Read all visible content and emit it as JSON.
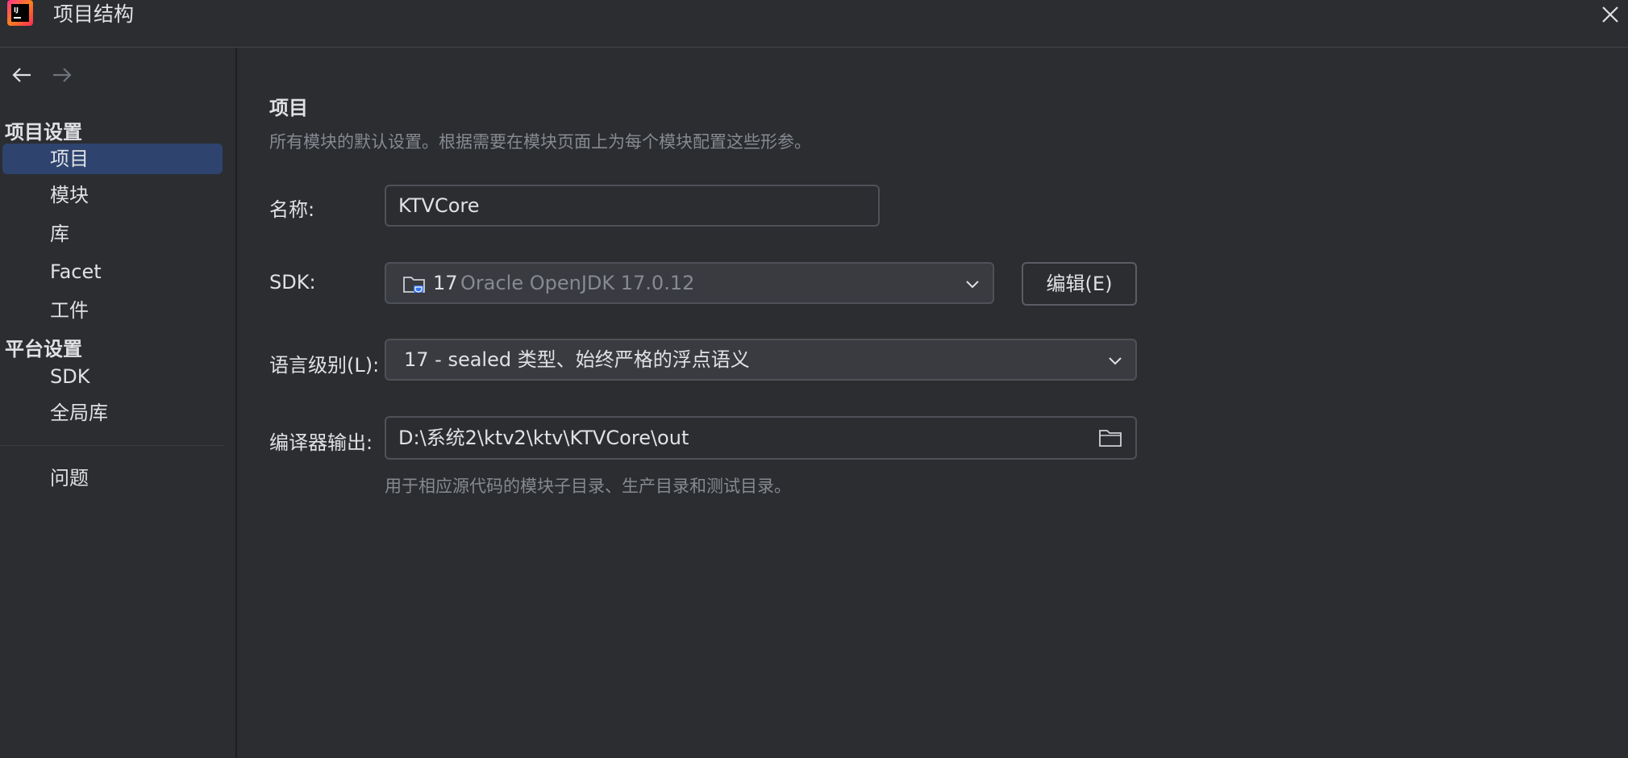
{
  "window": {
    "title": "项目结构",
    "logo_text": "IJ"
  },
  "sidebar": {
    "project_settings_title": "项目设置",
    "project_items": [
      {
        "label": "项目",
        "selected": true
      },
      {
        "label": "模块",
        "selected": false
      },
      {
        "label": "库",
        "selected": false
      },
      {
        "label": "Facet",
        "selected": false
      },
      {
        "label": "工件",
        "selected": false
      }
    ],
    "platform_settings_title": "平台设置",
    "platform_items": [
      {
        "label": "SDK"
      },
      {
        "label": "全局库"
      }
    ],
    "problems_label": "问题"
  },
  "main": {
    "heading": "项目",
    "description": "所有模块的默认设置。根据需要在模块页面上为每个模块配置这些形参。",
    "name_label": "名称:",
    "name_value": "KTVCore",
    "sdk_label": "SDK:",
    "sdk_version": "17",
    "sdk_name": "Oracle OpenJDK 17.0.12",
    "edit_button": "编辑(E)",
    "language_level_label": "语言级别(L):",
    "language_level_value": "17 - sealed 类型、始终严格的浮点语义",
    "compiler_output_label": "编译器输出:",
    "compiler_output_value": "D:\\系统2\\ktv2\\ktv\\KTVCore\\out",
    "compiler_output_hint": "用于相应源代码的模块子目录、生产目录和测试目录。"
  },
  "colors": {
    "background": "#2b2d30",
    "selection": "#2e436e",
    "text": "#dfe1e5",
    "muted_text": "#868a91",
    "border": "#4e5157"
  },
  "icons": [
    "intellij-logo-icon",
    "close-icon",
    "arrow-left-icon",
    "arrow-right-icon",
    "sdk-folder-icon",
    "chevron-down-icon",
    "folder-icon"
  ]
}
